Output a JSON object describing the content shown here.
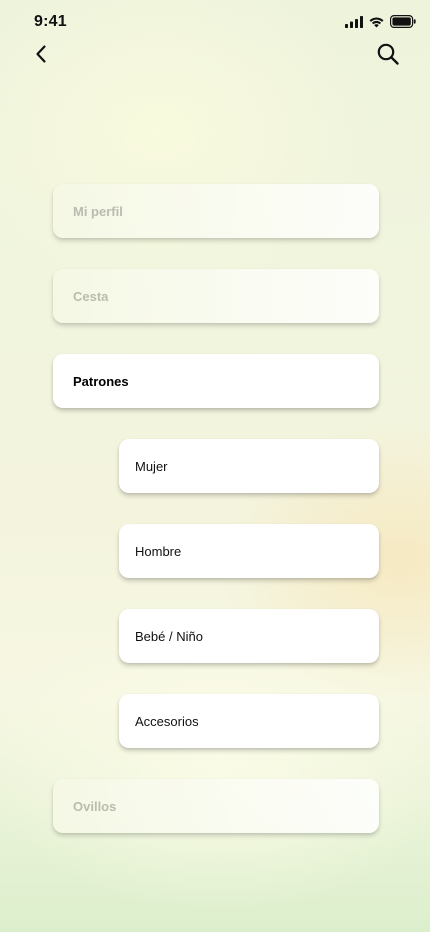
{
  "status_bar": {
    "time": "9:41",
    "icons": [
      "signal-icon",
      "wifi-icon",
      "battery-icon"
    ]
  },
  "nav": {
    "back_icon": "chevron-left-icon",
    "search_icon": "search-icon"
  },
  "menu": {
    "profile_label": "Mi perfil",
    "cart_label": "Cesta",
    "patterns_label": "Patrones",
    "patterns_sub": {
      "women_label": "Mujer",
      "men_label": "Hombre",
      "baby_label": "Bebé / Niño",
      "accessories_label": "Accesorios"
    },
    "yarn_label": "Ovillos",
    "selected": "Patrones"
  }
}
